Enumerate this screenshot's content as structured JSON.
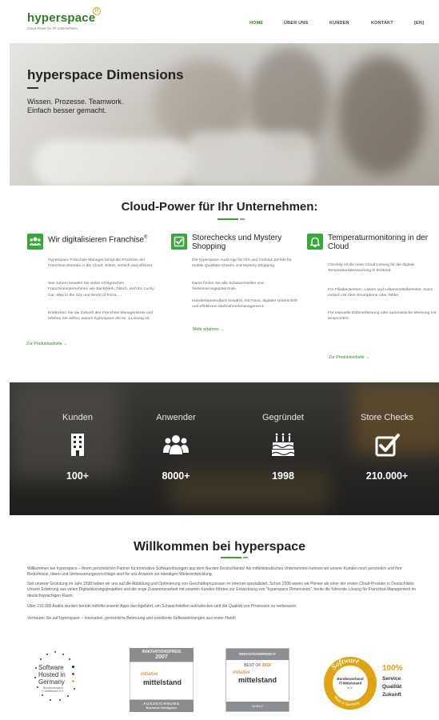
{
  "header": {
    "logo_text": "hyperspace",
    "logo_mark": "R",
    "tagline": "Cloud-Power für Ihr Unternehmen",
    "nav": [
      {
        "label": "HOME",
        "active": true
      },
      {
        "label": "ÜBER UNS",
        "active": false
      },
      {
        "label": "KUNDEN",
        "active": false
      },
      {
        "label": "KONTAKT",
        "active": false
      },
      {
        "label": "[EN]",
        "active": false
      }
    ]
  },
  "hero": {
    "title": "hyperspace Dimensions",
    "subtitle_line1": "Wissen. Prozesse. Teamwork.",
    "subtitle_line2": "Einfach besser gemacht."
  },
  "cloud": {
    "title": "Cloud-Power für Ihr Unternehmen:",
    "features": [
      {
        "icon": "team-icon",
        "title": "Wir digitalisieren Franchise",
        "title_sup": "®",
        "paragraphs": [
          "Hyperspace Franchise Manager bringt die Prozesse der Franchise-Zentrale in die Cloud: Sofort, einfach und effizient.",
          "Seit Jahren bewährt bei vielen erfolgreichen Franchiseunternehmen wie BackWerk, Ditsch, Hol'Ab!, Lucky Car, Wax in the City und World of Pizza, ...",
          "Entdecken Sie die Zukunft des Franchise Managements und erleben Sie selbst, warum hyperspace die Nr. 1 Lösung ist:"
        ],
        "link": "Zur Produktwebsite →"
      },
      {
        "icon": "checkbox-icon",
        "title": "Storechecks und Mystery Shopping",
        "title_sup": "",
        "paragraphs": [
          "Die hyperspace Audit App für iOS und Android: perfekt für mobile Qualitäts-Checks und Mystery Shopping.",
          "Damit finden Sie alle Schwachstellen und Verbesserungspotenziale.",
          "Hunderttausendfach bewährt, mit Fotos, digitaler Unterschrift und effektivem Maßnahmenmanagement."
        ],
        "link": "Mehr erfahren →"
      },
      {
        "icon": "bell-icon",
        "title": "Temperaturmonitoring in der Cloud",
        "title_sup": "",
        "paragraphs": [
          "Checkity ist die neue Cloud-Lösung für die digitale Temperaturüberwachung in Echtzeit:",
          "Für Filialbackereien, Labors und Lebensmittelbetriebe. Ganz einfach mit dem Smartphone oder Tablet.",
          "Für manuelle Datenerfassung oder automatische Messung mit tempcontrol."
        ],
        "link": "Zur Produktwebsite →"
      }
    ]
  },
  "stats": [
    {
      "label": "Kunden",
      "value": "100+",
      "icon": "building-icon"
    },
    {
      "label": "Anwender",
      "value": "8000+",
      "icon": "users-icon"
    },
    {
      "label": "Gegründet",
      "value": "1998",
      "icon": "birthday-cake-icon"
    },
    {
      "label": "Store Checks",
      "value": "210.000+",
      "icon": "check-square-icon"
    }
  ],
  "welcome": {
    "title": "Willkommen bei hyperspace",
    "paragraphs": [
      "Willkommen bei hyperspace – Ihrem persönlichen Partner für innovative Softwarelösungen aus dem Norden Deutschlands! Als mittelständisches Unternehmen kennen wir unsere Kunden noch persönlich und ihre Bedürfnisse, Ideen und Verbesserungsvorschläge sind für uns Ansporn zur ständigen Weiterentwicklung.",
      "Seit unserer Gründung im Jahr 1998 haben wir uns auf die Abbildung und Optimierung von Geschäftsprozessen im Internet spezialisiert. Schon 2006 waren wir Pionier als einer der ersten Cloud-Provider in Deutschland. Unsere Erfahrung aus vielen Digitalisierungsprojekten und die enge Zusammenarbeit mit unseren Kunden führten zur Entwicklung von \"hyperspace Dimensions\", heute die führende Lösung für Franchise-Management im deutschsprachigen Raum.",
      "Über 210.000 Audits wurden bereits mithilfe unserer Apps durchgeführt, um Schwachstellen aufzudecken und die Qualität von Prozessen zu verbessern.",
      "Vertrauen Sie auf hyperspace – Innovation, persönliche Betreuung und exzellente Softwarelösungen aus erster Hand!"
    ]
  },
  "badges": {
    "software_hosted": {
      "line1": "Software",
      "line2": "Hosted in",
      "line3": "Germany",
      "line4": "Bundesverband",
      "line5": "IT-Mittelstand e.V."
    },
    "innovationspreis_2007": {
      "top": "INNOVATIONSPREIS",
      "year": "2007",
      "script": "initiative",
      "word": "mittelstand",
      "bottom": "AUSZEICHNUNG",
      "bottom2": "Business Intelligence"
    },
    "innovationspreis_it": {
      "top": "INNOVATIONSPREIS-IT",
      "best": "BEST OF",
      "year": "2016",
      "script": "initiative",
      "word": "mittelstand",
      "bottom": "MOBILE"
    },
    "software_seal": {
      "arc_top": "Software",
      "arc_bottom": "Made in Germany",
      "org1": "Bundesverband",
      "org2": "IT-Mittelstand",
      "org3": "e.V.",
      "p1": "100%",
      "p2": "Service",
      "p3": "Qualität",
      "p4": "Zukunft"
    }
  },
  "colors": {
    "brand_green": "#2f7d25",
    "accent_green": "#37a83a",
    "accent_orange": "#e79a1b"
  }
}
